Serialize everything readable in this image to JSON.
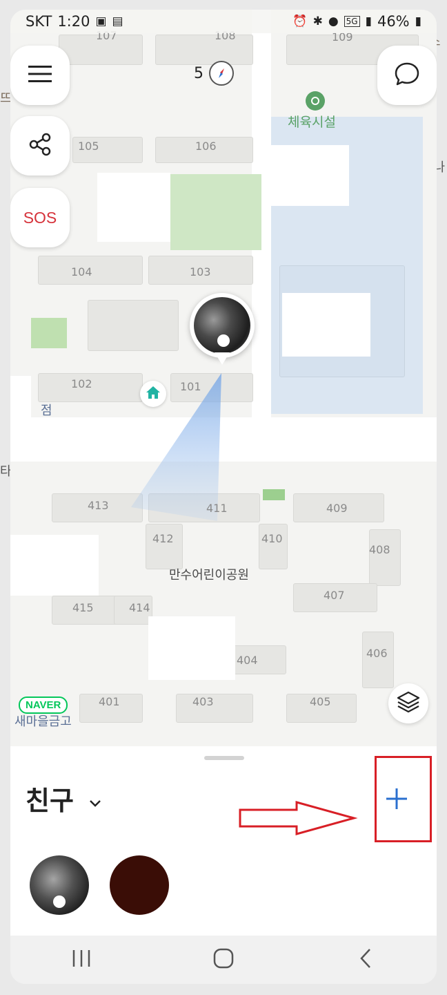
{
  "status_bar": {
    "carrier": "SKT",
    "time": "1:20",
    "network": "5G",
    "battery": "46%"
  },
  "map": {
    "building_labels": [
      "107",
      "108",
      "109",
      "105",
      "106",
      "104",
      "103",
      "102",
      "101",
      "413",
      "411",
      "409",
      "412",
      "410",
      "408",
      "415",
      "414",
      "407",
      "404",
      "406",
      "401",
      "403",
      "405"
    ],
    "park_label": "체육시설",
    "place_label": "만수어린이공원",
    "compass_value": "5",
    "provider": "NAVER"
  },
  "floating_buttons": {
    "menu_icon": "hamburger-icon",
    "share_icon": "share-icon",
    "sos_label": "SOS",
    "chat_icon": "chat-bubble-icon",
    "layers_icon": "layers-icon"
  },
  "sheet": {
    "title": "친구",
    "add_icon": "plus-icon",
    "friends": [
      {
        "name": "friend-1",
        "color": "#3e3e3e"
      },
      {
        "name": "friend-2",
        "color": "#3a0d06"
      }
    ]
  },
  "edge_labels": {
    "right_top": "스",
    "right_mid": "하나",
    "left_top": "뜨",
    "left_mid": "점",
    "left_mid2": "타워",
    "left_bottom": "새마을금고"
  },
  "colors": {
    "accent_blue": "#2a6fcf",
    "sos_red": "#d6333b",
    "annotation_red": "#d81f26",
    "park_green": "#5aa267"
  }
}
